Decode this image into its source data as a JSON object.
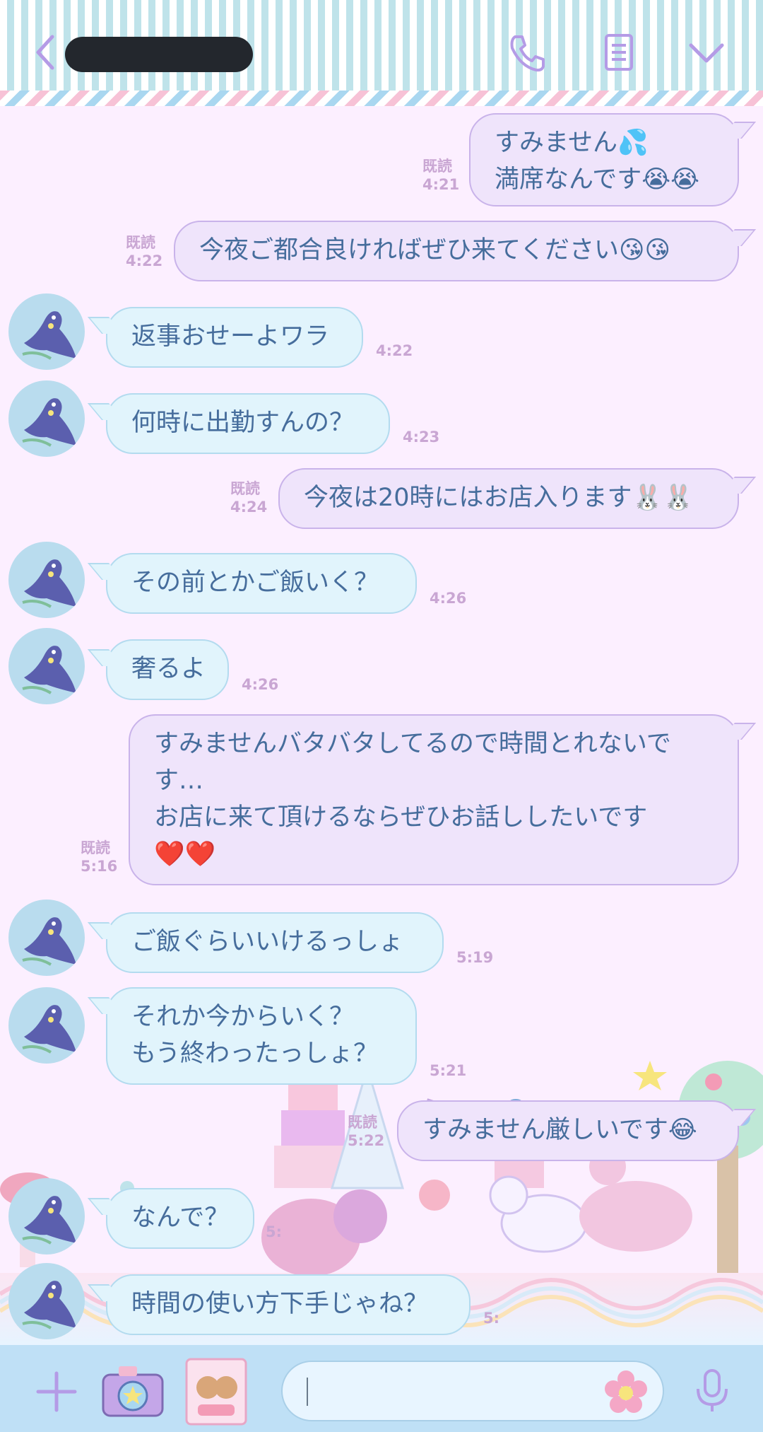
{
  "header": {
    "contact_name": "",
    "icons": [
      "back-chevron-icon",
      "phone-icon",
      "notes-icon",
      "chevron-down-icon"
    ],
    "accent_color": "#b49be6"
  },
  "messages": [
    {
      "side": "out",
      "lines": [
        "すみません💦",
        "満席なんです😭😭"
      ],
      "read": "既読",
      "time": "4:21"
    },
    {
      "side": "out",
      "lines": [
        "今夜ご都合良ければぜひ来てください😘😘"
      ],
      "read": "既読",
      "time": "4:22"
    },
    {
      "side": "in",
      "lines": [
        "返事おせーよワラ"
      ],
      "time": "4:22"
    },
    {
      "side": "in",
      "lines": [
        "何時に出勤すんの？"
      ],
      "time": "4:23"
    },
    {
      "side": "out",
      "lines": [
        "今夜は20時にはお店入ります🐰🐰"
      ],
      "read": "既読",
      "time": "4:24"
    },
    {
      "side": "in",
      "lines": [
        "その前とかご飯いく？"
      ],
      "time": "4:26"
    },
    {
      "side": "in",
      "lines": [
        "奢るよ"
      ],
      "time": "4:26"
    },
    {
      "side": "out",
      "lines": [
        "すみませんバタバタしてるので時間とれないで",
        "す…",
        "お店に来て頂けるならぜひお話ししたいです",
        "❤️❤️"
      ],
      "read": "既読",
      "time": "5:16"
    },
    {
      "side": "in",
      "lines": [
        "ご飯ぐらいいけるっしょ"
      ],
      "time": "5:19"
    },
    {
      "side": "in",
      "lines": [
        "それか今からいく？",
        "もう終わったっしょ？"
      ],
      "time": "5:21"
    },
    {
      "side": "out",
      "lines": [
        "すみません厳しいです😂"
      ],
      "read": "既読",
      "time": "5:22"
    },
    {
      "side": "in",
      "lines": [
        "なんで？"
      ],
      "time": "5:"
    },
    {
      "side": "in",
      "lines": [
        "時間の使い方下手じゃね？"
      ],
      "time": "5:"
    }
  ],
  "input_bar": {
    "placeholder": "",
    "icons": [
      "plus-icon",
      "camera-icon",
      "sticker-icon",
      "flower-emoji-icon",
      "microphone-icon"
    ]
  },
  "colors": {
    "chat_background": "#fcefff",
    "incoming_bubble": "#e1f4fc",
    "outgoing_bubble": "#efe4fb",
    "text": "#466d9c",
    "meta": "#c9a6d3",
    "input_bar": "#bfe0f6"
  }
}
